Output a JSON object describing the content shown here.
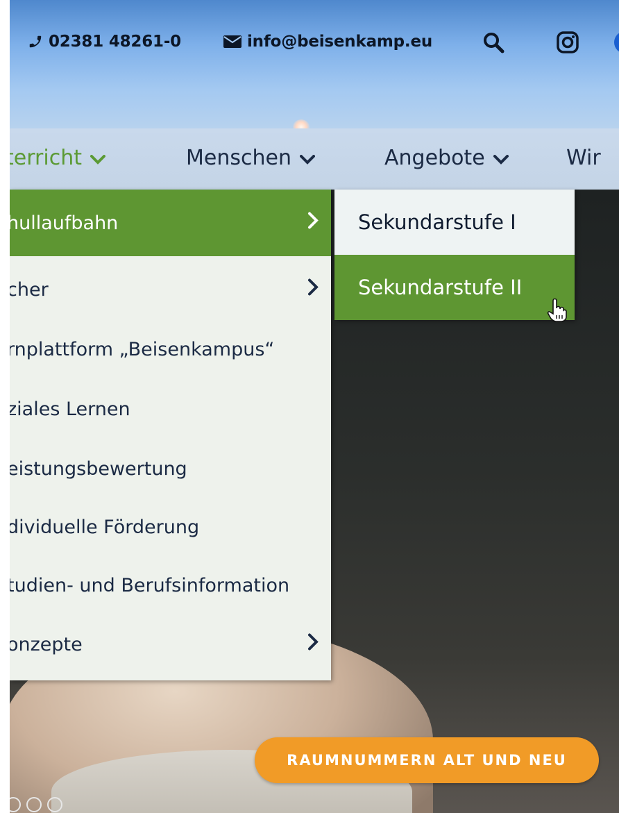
{
  "topbar": {
    "phone": "02381 48261-0",
    "email": "info@beisenkamp.eu",
    "icons": [
      "phone-icon",
      "envelope-icon",
      "search-icon",
      "instagram-icon",
      "facebook-icon"
    ]
  },
  "nav": {
    "items": [
      {
        "label": "terricht",
        "active": true
      },
      {
        "label": "Menschen"
      },
      {
        "label": "Angebote"
      },
      {
        "label": "Wir"
      }
    ]
  },
  "dropdown": {
    "items": [
      {
        "label": "hullaufbahn",
        "has_submenu": true,
        "active": true
      },
      {
        "label": "cher",
        "has_submenu": true
      },
      {
        "label": "rnplattform „Beisenkampus“"
      },
      {
        "label": "ziales Lernen"
      },
      {
        "label": "eistungsbewertung"
      },
      {
        "label": "dividuelle Förderung"
      },
      {
        "label": "tudien- und Berufsinformation"
      },
      {
        "label": "onzepte",
        "has_submenu": true
      }
    ]
  },
  "submenu": {
    "items": [
      {
        "label": "Sekundarstufe I"
      },
      {
        "label": "Sekundarstufe II",
        "active": true
      }
    ]
  },
  "cta": {
    "label": "RAUMNUMMERN ALT UND NEU"
  },
  "colors": {
    "accent_green": "#5e9632",
    "cta_orange": "#f19b27",
    "nav_text": "#1b2a44"
  }
}
